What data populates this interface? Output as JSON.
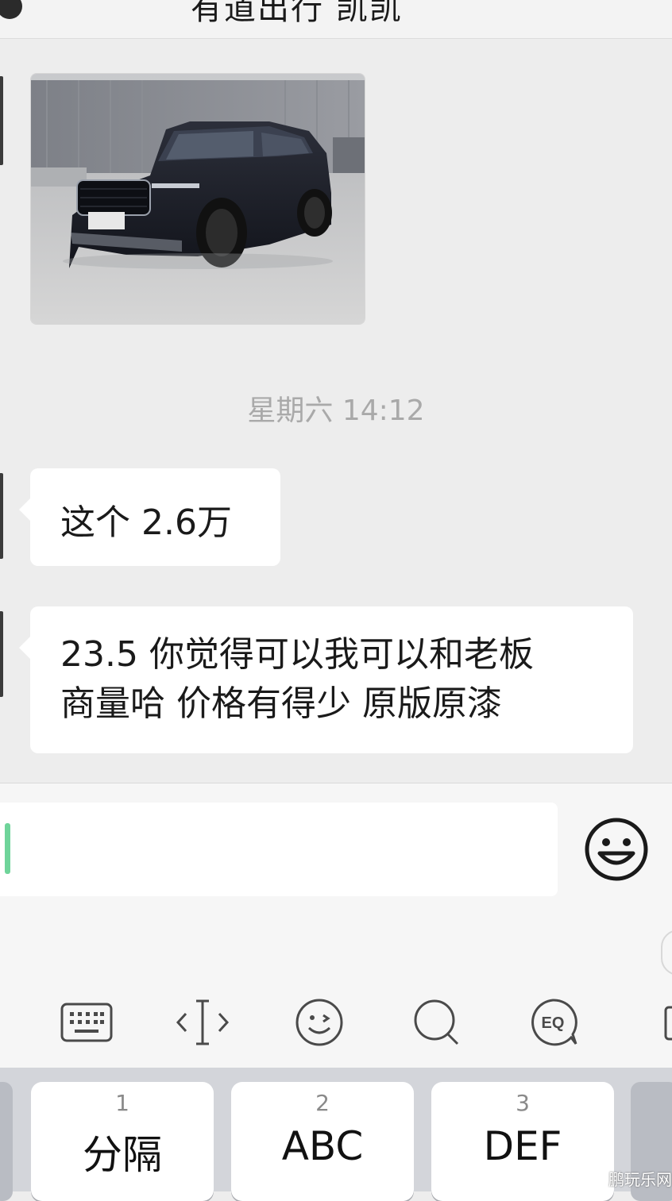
{
  "header": {
    "title": "有道出行 凯凯"
  },
  "chat": {
    "timestamp": "星期六 14:12",
    "messages": [
      {
        "text": "这个 2.6万"
      },
      {
        "line1": "23.5 你觉得可以我可以和老板",
        "line2": "商量哈 价格有得少 原版原漆"
      }
    ]
  },
  "input": {
    "value": ""
  },
  "keyboard": {
    "toolbar": [
      "keyboard-icon",
      "cursor-move-icon",
      "emoji-face-icon",
      "search-icon",
      "eq-icon"
    ],
    "keys": [
      {
        "num": "1",
        "label": "分隔"
      },
      {
        "num": "2",
        "label": "ABC"
      },
      {
        "num": "3",
        "label": "DEF"
      }
    ]
  },
  "watermark": "鹏玩乐网",
  "colors": {
    "background": "#ededed",
    "bubble": "#ffffff",
    "caret": "#6fd49a",
    "timestamp": "#a9a9a9"
  }
}
